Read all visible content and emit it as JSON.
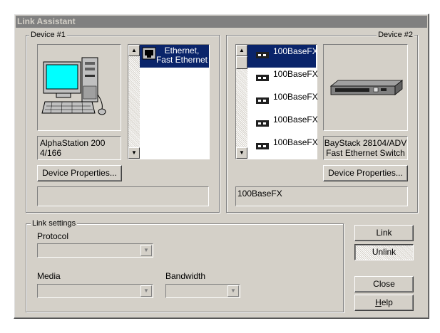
{
  "window": {
    "title": "Link Assistant"
  },
  "device1": {
    "group_label": "Device #1",
    "name": "AlphaStation 200 4/166",
    "properties_button": "Device Properties...",
    "status": "",
    "ports": [
      {
        "label": "Ethernet, Fast Ethernet",
        "selected": true
      }
    ]
  },
  "device2": {
    "group_label": "Device #2",
    "name_line1": "BayStack 28104/ADV",
    "name_line2": "Fast Ethernet Switch",
    "properties_button": "Device Properties...",
    "status": "100BaseFX",
    "ports": [
      {
        "label": "100BaseFX",
        "selected": true
      },
      {
        "label": "100BaseFX",
        "selected": false
      },
      {
        "label": "100BaseFX",
        "selected": false
      },
      {
        "label": "100BaseFX",
        "selected": false
      },
      {
        "label": "100BaseFX",
        "selected": false
      }
    ]
  },
  "link_settings": {
    "group_label": "Link settings",
    "protocol_label": "Protocol",
    "protocol_value": "",
    "media_label": "Media",
    "media_value": "",
    "bandwidth_label": "Bandwidth",
    "bandwidth_value": ""
  },
  "buttons": {
    "link": "Link",
    "unlink": "Unlink",
    "close": "Close",
    "help_prefix": "",
    "help_accel": "H",
    "help_rest": "elp"
  },
  "colors": {
    "selection": "#0a246a",
    "face": "#d4d0c8",
    "monitor_screen": "#00ffff"
  }
}
